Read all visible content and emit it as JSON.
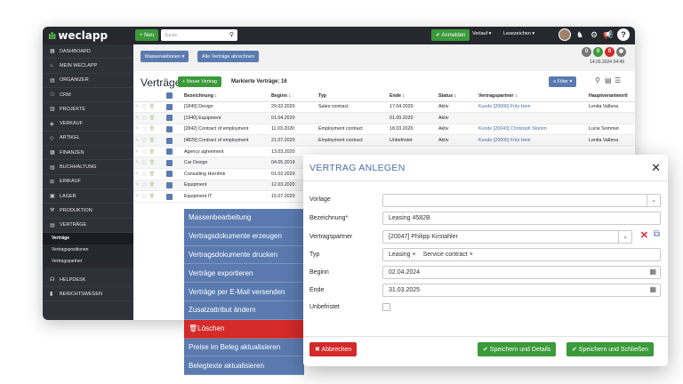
{
  "topbar": {
    "logo": "weclapp",
    "new_label": "+ Neu",
    "search_placeholder": "Suche",
    "login_label": "✔ Anmelden",
    "history_label": "Verlauf ▾",
    "bookmarks_label": "Lesezeichen ▾",
    "help_label": "?"
  },
  "sidebar": {
    "items": [
      {
        "icon": "▦",
        "label": "DASHBOARD"
      },
      {
        "icon": "⌂",
        "label": "MEIN WECLAPP"
      },
      {
        "icon": "▤",
        "label": "ORGANIZER"
      },
      {
        "icon": "⚇",
        "label": "CRM"
      },
      {
        "icon": "▥",
        "label": "PROJEKTE"
      },
      {
        "icon": "◈",
        "label": "VERKAUF"
      },
      {
        "icon": "◇",
        "label": "ARTIKEL"
      },
      {
        "icon": "▦",
        "label": "FINANZEN"
      },
      {
        "icon": "▤",
        "label": "BUCHHALTUNG"
      },
      {
        "icon": "⊞",
        "label": "EINKAUF"
      },
      {
        "icon": "▣",
        "label": "LAGER"
      },
      {
        "icon": "⚒",
        "label": "PRODUKTION"
      },
      {
        "icon": "▤",
        "label": "VERTRÄGE"
      }
    ],
    "subitems": [
      {
        "label": "Verträge",
        "active": true
      },
      {
        "label": "Vertragspositionen",
        "active": false
      },
      {
        "label": "Vertragspartner",
        "active": false
      }
    ],
    "bottom": [
      {
        "icon": "☊",
        "label": "HELPDESK"
      },
      {
        "icon": "▮",
        "label": "BERICHTSWESEN"
      }
    ]
  },
  "content": {
    "mass_actions": "Massenaktionen ▾",
    "cancel_all": "Alle Verträge abrechnen",
    "badges": [
      "0",
      "0",
      "0"
    ],
    "date": "14.03.2024 04:49",
    "title": "Verträge",
    "new_contract": "+ Neuer Vertrag",
    "marked": "Markierte Verträge: 16",
    "filter": "≡ Filter ▾",
    "columns": [
      "",
      "",
      "Bezeichnung ↕",
      "Beginn ↕",
      "Typ",
      "Ende ↕",
      "Status ↕",
      "Vertragspartner ↕",
      "Hauptverantwortl"
    ],
    "rows": [
      {
        "name": "[1849] Design",
        "begin": "29.02.2020",
        "type": "Sales contract",
        "end": "17.04.2020",
        "status": "Aktiv",
        "partner": "Kunde [20006] Fritz Hein",
        "owner": "Lenita Vallena"
      },
      {
        "name": "[1940] Equipment",
        "begin": "01.04.2020",
        "type": "",
        "end": "01.09.2020",
        "status": "Aktiv",
        "partner": "",
        "owner": ""
      },
      {
        "name": "[2842] Contract of employment",
        "begin": "11.03.2020",
        "type": "Employment contract",
        "end": "18.03.2020",
        "status": "Aktiv",
        "partner": "Kunde [20043] Christoph Stumm",
        "owner": "Lucie Sommer"
      },
      {
        "name": "[4829] Contract of employment",
        "begin": "21.07.2020",
        "type": "Employment contract",
        "end": "Unbefristet",
        "status": "Aktiv",
        "partner": "Kunde [20006] Fritz Hein",
        "owner": "Lenita Vallena"
      },
      {
        "name": "Agency agreement",
        "begin": "13.03.2020",
        "type": "",
        "end": "",
        "status": "",
        "partner": "",
        "owner": ""
      },
      {
        "name": "Car Design",
        "begin": "04.05.2019",
        "type": "",
        "end": "",
        "status": "",
        "partner": "",
        "owner": ""
      },
      {
        "name": "Consulting Hornfink",
        "begin": "01.02.2020",
        "type": "",
        "end": "",
        "status": "",
        "partner": "",
        "owner": ""
      },
      {
        "name": "Equipment",
        "begin": "12.03.2020",
        "type": "",
        "end": "",
        "status": "",
        "partner": "",
        "owner": ""
      },
      {
        "name": "Equipment IT",
        "begin": "15.07.2020",
        "type": "",
        "end": "",
        "status": "",
        "partner": "",
        "owner": ""
      }
    ]
  },
  "context_menu": [
    "Massenbearbeitung",
    "Vertragsdokumente erzeugen",
    "Vertragsdokumente drucken",
    "Verträge exportieren",
    "Verträge per E-Mail versenden",
    "Zusatzattribut ändern",
    "Löschen",
    "Preise im Beleg aktualisieren",
    "Belegtexte aktualisieren"
  ],
  "modal": {
    "title": "VERTRAG ANLEGEN",
    "close": "✕",
    "labels": {
      "vorlage": "Vorlage",
      "bezeichnung": "Bezeichnung*",
      "partner": "Vertragspartner",
      "typ": "Typ",
      "beginn": "Beginn",
      "ende": "Ende",
      "unbefristet": "Unbefristet"
    },
    "values": {
      "vorlage": "",
      "bezeichnung": "Leasing 4582B",
      "partner": "[20047] Philipp Kirstahler",
      "typ_tags": [
        "Leasing  ×",
        "Service contract  ×"
      ],
      "beginn": "02.04.2024",
      "ende": "31.03.2025"
    },
    "cancel": "✖ Abbrechen",
    "save_details": "✔ Speichern und Details",
    "save_close": "✔ Speichern und Schließen"
  },
  "colors": {
    "green": "#3b9a3a",
    "blue": "#5b7bb0",
    "red": "#d42a2a",
    "dark": "#26282e"
  }
}
